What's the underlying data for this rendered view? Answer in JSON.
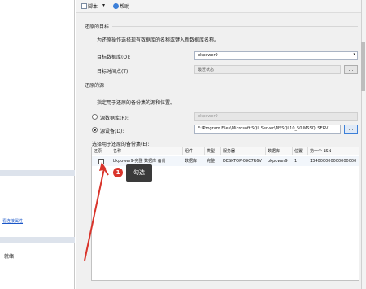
{
  "toolbar": {
    "script_label": "脚本",
    "help_label": "帮助"
  },
  "target": {
    "group_label": "还原的目标",
    "hint": "为还原操作选择现有数据库的名称或键入新数据库名称。",
    "db_label": "目标数据库(O):",
    "db_value": "bkpower9",
    "time_label": "目标时间点(T):",
    "time_value": "最近状态",
    "browse_label": "..."
  },
  "source": {
    "group_label": "还原的源",
    "hint": "指定用于还原的备份集的源和位置。",
    "from_db_label": "源数据库(R):",
    "from_db_value": "bkpower9",
    "from_device_label": "源设备(D):",
    "device_value": "E:\\Program Files\\Microsoft SQL Server\\MSSQL10_50.MSSQLSERV",
    "browse_label": "..."
  },
  "grid": {
    "title": "选择用于还原的备份集(E):",
    "columns": [
      "还原",
      "名称",
      "组件",
      "类型",
      "服务器",
      "数据库",
      "位置",
      "第一个 LSN"
    ],
    "row": {
      "name": "bkpower9-完整 数据库 备份",
      "component": "数据库",
      "type": "完整",
      "server": "DESKTOP-09C7R6V",
      "database": "bkpower9",
      "position": "1",
      "first_lsn": "134000000000000000"
    }
  },
  "annotation": {
    "number": "1",
    "text": "勾选"
  },
  "sidebar": {
    "link_text": "看连接属性",
    "status_text": "就绪"
  },
  "colors": {
    "accent": "#3c7fd8",
    "annotation_red": "#d9342b",
    "annotation_bg": "#3a3a3a"
  }
}
